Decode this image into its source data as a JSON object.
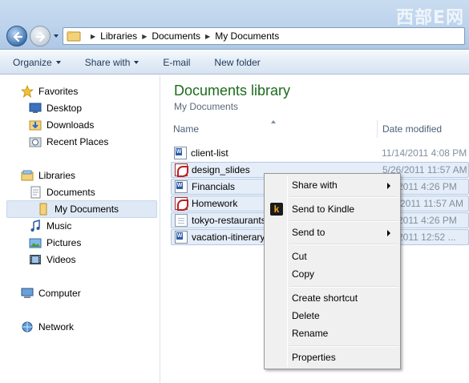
{
  "watermark": "西部E网",
  "address": {
    "crumbs": [
      "Libraries",
      "Documents",
      "My Documents"
    ]
  },
  "toolbar": {
    "organize": "Organize",
    "share_with": "Share with",
    "email": "E-mail",
    "new_folder": "New folder"
  },
  "nav": {
    "favorites": "Favorites",
    "desktop": "Desktop",
    "downloads": "Downloads",
    "recent_places": "Recent Places",
    "libraries": "Libraries",
    "documents": "Documents",
    "my_documents": "My Documents",
    "music": "Music",
    "pictures": "Pictures",
    "videos": "Videos",
    "computer": "Computer",
    "network": "Network"
  },
  "content": {
    "title": "Documents library",
    "subtitle": "My Documents",
    "columns": {
      "name": "Name",
      "date_modified": "Date modified"
    },
    "files": [
      {
        "name": "client-list",
        "date": "11/14/2011 4:08 PM",
        "icon": "word-doc-icon",
        "selected": false
      },
      {
        "name": "design_slides",
        "date": "5/26/2011 11:57 AM",
        "icon": "pdf-icon",
        "selected": true
      },
      {
        "name": "Financials",
        "date": "8/2011 4:26 PM",
        "icon": "word-doc-icon",
        "selected": true
      },
      {
        "name": "Homework",
        "date": "2011 11:57 AM",
        "icon": "pdf-icon",
        "selected": true
      },
      {
        "name": "tokyo-restaurants",
        "date": "8/2011 4:26 PM",
        "icon": "text-file-icon",
        "selected": true
      },
      {
        "name": "vacation-itinerary",
        "date": "7/2011 12:52 ...",
        "icon": "word-doc-icon",
        "selected": true
      }
    ]
  },
  "context_menu": {
    "share_with": "Share with",
    "send_to_kindle": "Send to Kindle",
    "send_to": "Send to",
    "cut": "Cut",
    "copy": "Copy",
    "create_shortcut": "Create shortcut",
    "delete": "Delete",
    "rename": "Rename",
    "properties": "Properties"
  },
  "colors": {
    "library_title": "#1d6b1d",
    "selection": "#e4edf8",
    "toolbar_text": "#1e395b"
  }
}
